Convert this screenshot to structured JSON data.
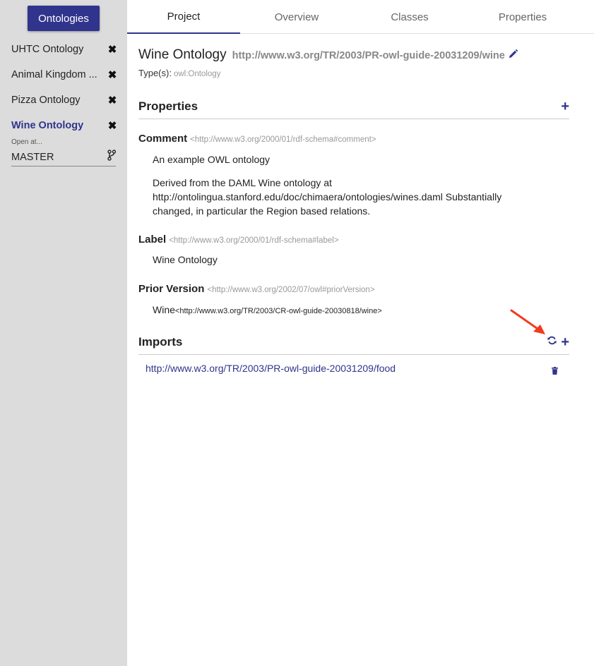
{
  "sidebar": {
    "ontologies_button": "Ontologies",
    "items": [
      {
        "label": "UHTC Ontology",
        "close": "✖"
      },
      {
        "label": "Animal Kingdom ...",
        "close": "✖"
      },
      {
        "label": "Pizza Ontology",
        "close": "✖"
      },
      {
        "label": "Wine Ontology",
        "close": "✖"
      }
    ],
    "open_at_label": "Open at...",
    "branch": "MASTER"
  },
  "tabs": [
    "Project",
    "Overview",
    "Classes",
    "Properties"
  ],
  "active_tab": "Project",
  "header": {
    "title": "Wine Ontology",
    "iri": "http://www.w3.org/TR/2003/PR-owl-guide-20031209/wine",
    "types_label": "Type(s):",
    "types_value": "owl:Ontology"
  },
  "properties_section": {
    "title": "Properties",
    "add": "+",
    "items": [
      {
        "name": "Comment",
        "iri": "<http://www.w3.org/2000/01/rdf-schema#comment>",
        "values": [
          "An example OWL ontology",
          "Derived from the DAML Wine ontology at http://ontolingua.stanford.edu/doc/chimaera/ontologies/wines.daml Substantially changed, in particular the Region based relations."
        ]
      },
      {
        "name": "Label",
        "iri": "<http://www.w3.org/2000/01/rdf-schema#label>",
        "values": [
          "Wine Ontology"
        ]
      },
      {
        "name": "Prior Version",
        "iri": "<http://www.w3.org/2002/07/owl#priorVersion>",
        "value_main": "Wine",
        "value_iri": "<http://www.w3.org/TR/2003/CR-owl-guide-20030818/wine>"
      }
    ]
  },
  "imports_section": {
    "title": "Imports",
    "add": "+",
    "items": [
      "http://www.w3.org/TR/2003/PR-owl-guide-20031209/food"
    ]
  },
  "colors": {
    "accent": "#30348c",
    "sidebar_bg": "#dcdcdc",
    "annotation_arrow": "#f03c1e"
  }
}
